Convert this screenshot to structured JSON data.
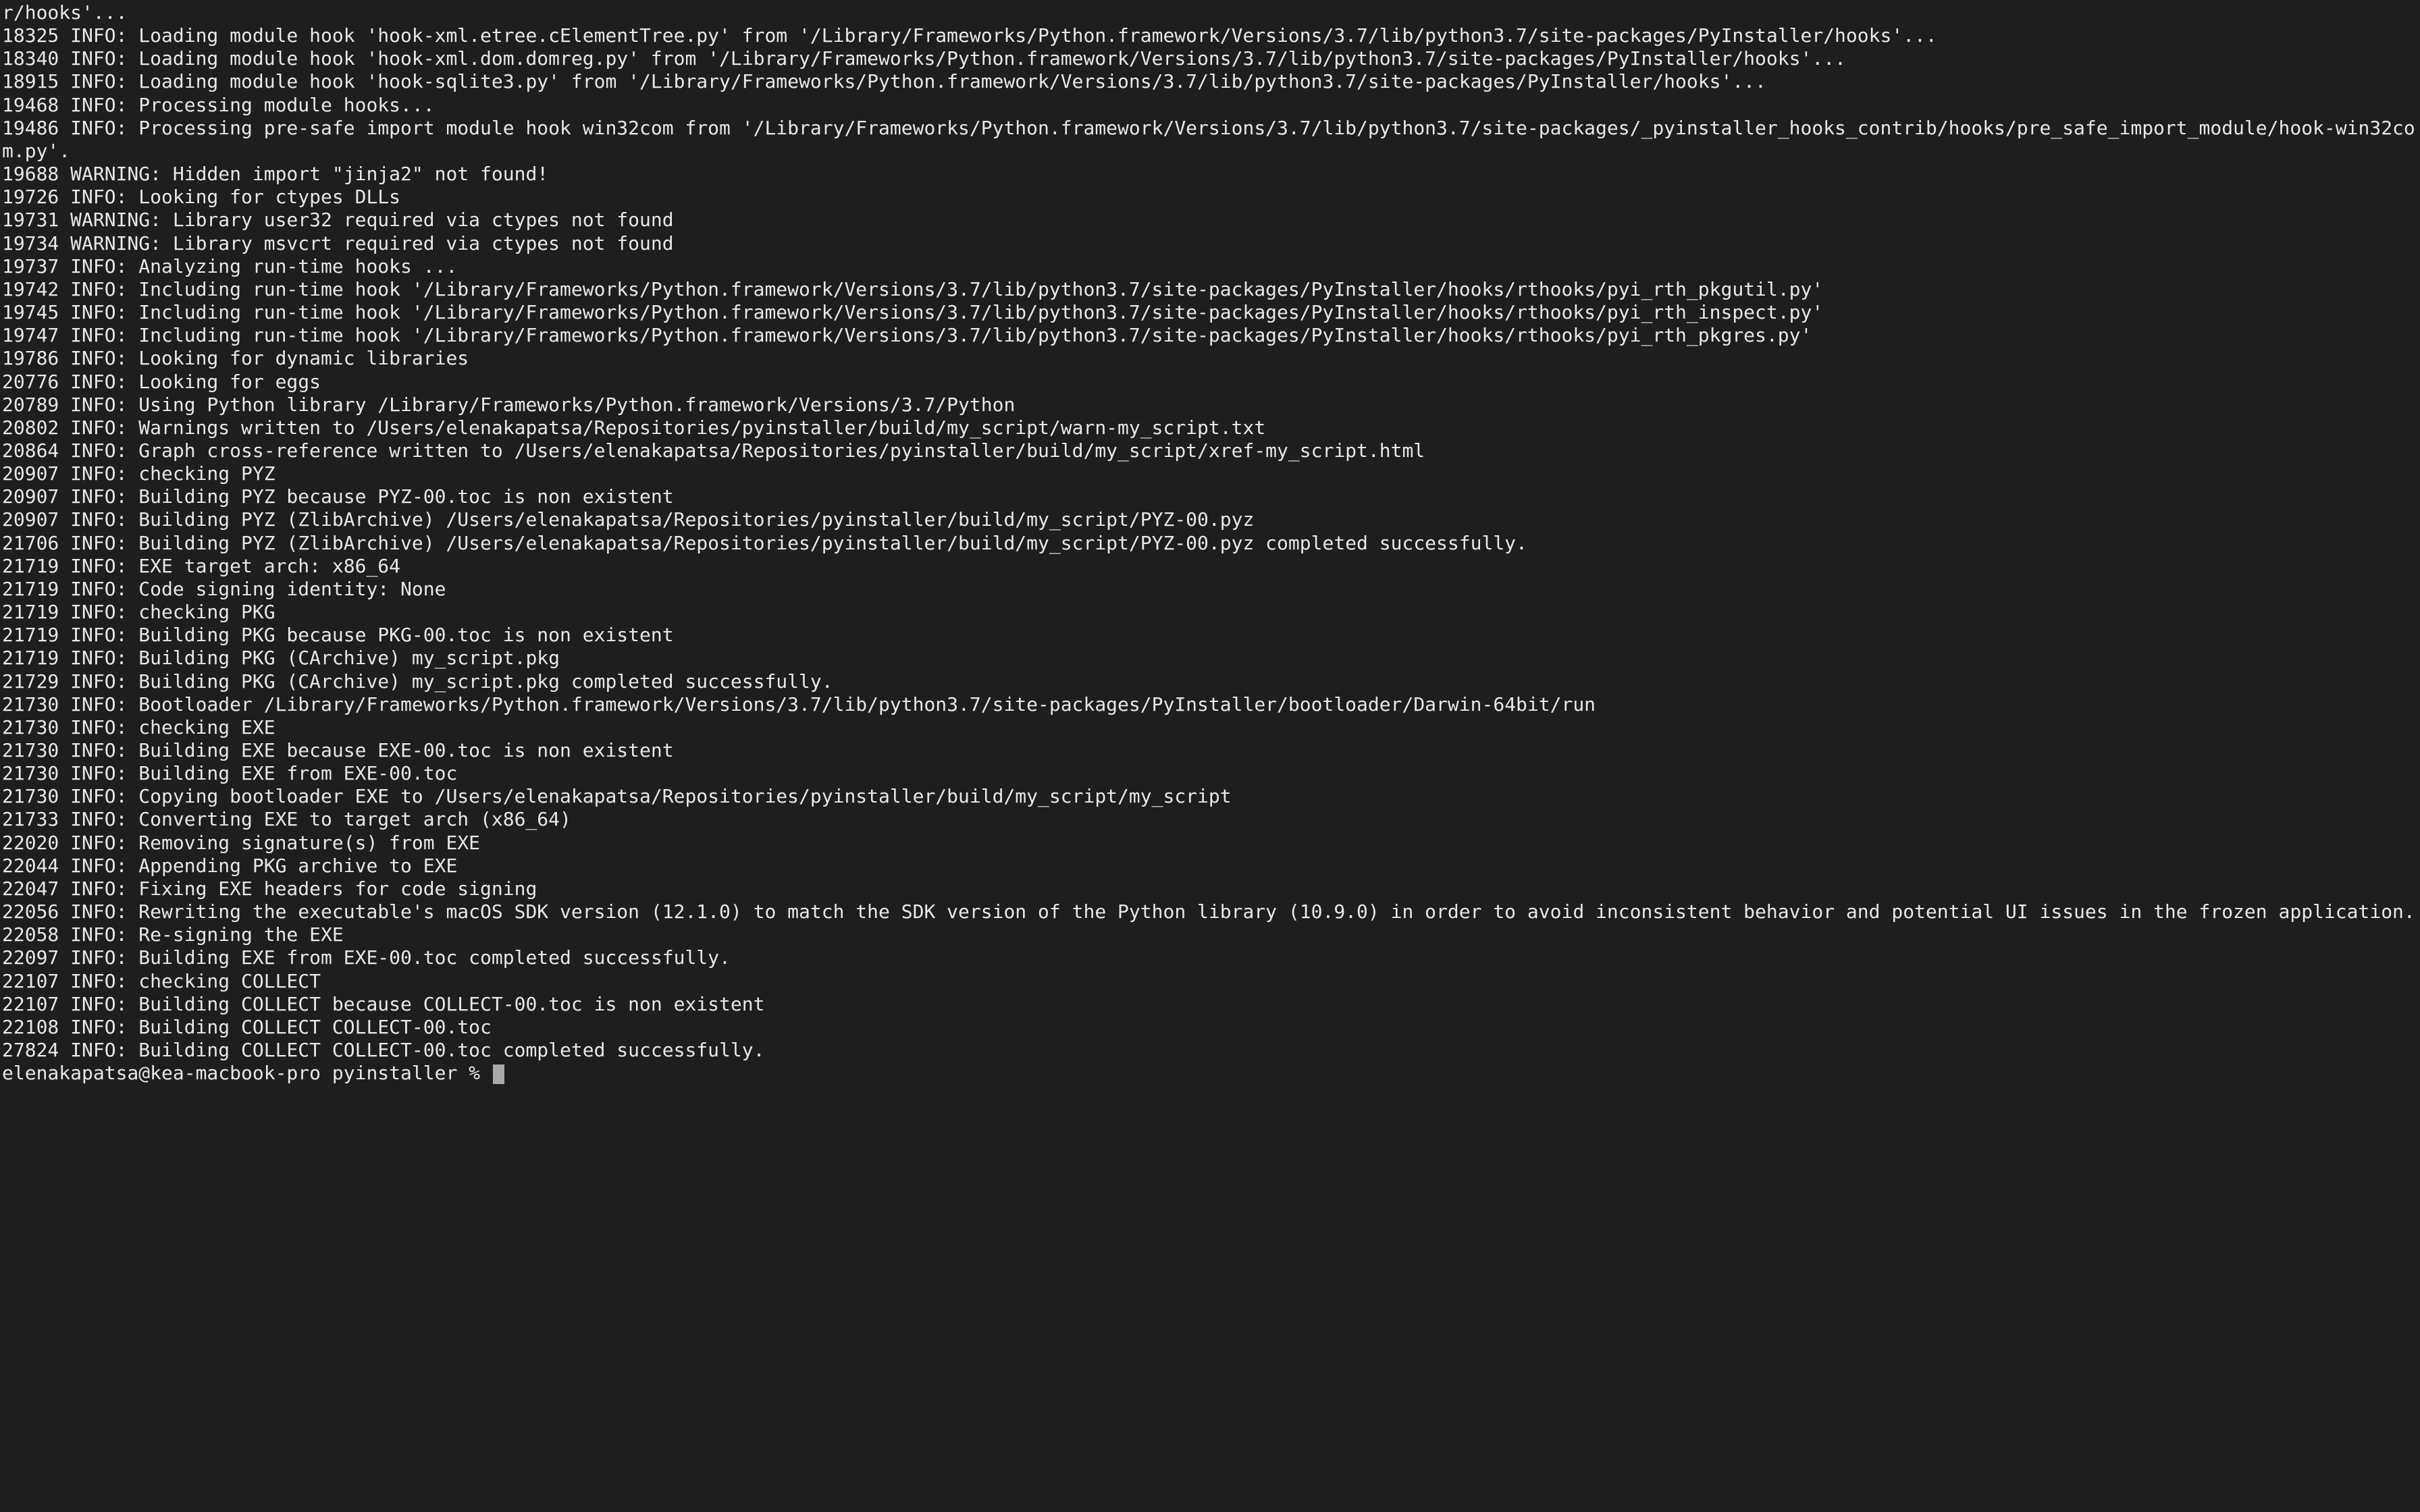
{
  "terminal": {
    "lines": [
      "r/hooks'...",
      "18325 INFO: Loading module hook 'hook-xml.etree.cElementTree.py' from '/Library/Frameworks/Python.framework/Versions/3.7/lib/python3.7/site-packages/PyInstaller/hooks'...",
      "18340 INFO: Loading module hook 'hook-xml.dom.domreg.py' from '/Library/Frameworks/Python.framework/Versions/3.7/lib/python3.7/site-packages/PyInstaller/hooks'...",
      "18915 INFO: Loading module hook 'hook-sqlite3.py' from '/Library/Frameworks/Python.framework/Versions/3.7/lib/python3.7/site-packages/PyInstaller/hooks'...",
      "19468 INFO: Processing module hooks...",
      "19486 INFO: Processing pre-safe import module hook win32com from '/Library/Frameworks/Python.framework/Versions/3.7/lib/python3.7/site-packages/_pyinstaller_hooks_contrib/hooks/pre_safe_import_module/hook-win32com.py'.",
      "19688 WARNING: Hidden import \"jinja2\" not found!",
      "19726 INFO: Looking for ctypes DLLs",
      "19731 WARNING: Library user32 required via ctypes not found",
      "19734 WARNING: Library msvcrt required via ctypes not found",
      "19737 INFO: Analyzing run-time hooks ...",
      "19742 INFO: Including run-time hook '/Library/Frameworks/Python.framework/Versions/3.7/lib/python3.7/site-packages/PyInstaller/hooks/rthooks/pyi_rth_pkgutil.py'",
      "19745 INFO: Including run-time hook '/Library/Frameworks/Python.framework/Versions/3.7/lib/python3.7/site-packages/PyInstaller/hooks/rthooks/pyi_rth_inspect.py'",
      "19747 INFO: Including run-time hook '/Library/Frameworks/Python.framework/Versions/3.7/lib/python3.7/site-packages/PyInstaller/hooks/rthooks/pyi_rth_pkgres.py'",
      "19786 INFO: Looking for dynamic libraries",
      "20776 INFO: Looking for eggs",
      "20789 INFO: Using Python library /Library/Frameworks/Python.framework/Versions/3.7/Python",
      "20802 INFO: Warnings written to /Users/elenakapatsa/Repositories/pyinstaller/build/my_script/warn-my_script.txt",
      "20864 INFO: Graph cross-reference written to /Users/elenakapatsa/Repositories/pyinstaller/build/my_script/xref-my_script.html",
      "20907 INFO: checking PYZ",
      "20907 INFO: Building PYZ because PYZ-00.toc is non existent",
      "20907 INFO: Building PYZ (ZlibArchive) /Users/elenakapatsa/Repositories/pyinstaller/build/my_script/PYZ-00.pyz",
      "21706 INFO: Building PYZ (ZlibArchive) /Users/elenakapatsa/Repositories/pyinstaller/build/my_script/PYZ-00.pyz completed successfully.",
      "21719 INFO: EXE target arch: x86_64",
      "21719 INFO: Code signing identity: None",
      "21719 INFO: checking PKG",
      "21719 INFO: Building PKG because PKG-00.toc is non existent",
      "21719 INFO: Building PKG (CArchive) my_script.pkg",
      "21729 INFO: Building PKG (CArchive) my_script.pkg completed successfully.",
      "21730 INFO: Bootloader /Library/Frameworks/Python.framework/Versions/3.7/lib/python3.7/site-packages/PyInstaller/bootloader/Darwin-64bit/run",
      "21730 INFO: checking EXE",
      "21730 INFO: Building EXE because EXE-00.toc is non existent",
      "21730 INFO: Building EXE from EXE-00.toc",
      "21730 INFO: Copying bootloader EXE to /Users/elenakapatsa/Repositories/pyinstaller/build/my_script/my_script",
      "21733 INFO: Converting EXE to target arch (x86_64)",
      "22020 INFO: Removing signature(s) from EXE",
      "22044 INFO: Appending PKG archive to EXE",
      "22047 INFO: Fixing EXE headers for code signing",
      "22056 INFO: Rewriting the executable's macOS SDK version (12.1.0) to match the SDK version of the Python library (10.9.0) in order to avoid inconsistent behavior and potential UI issues in the frozen application.",
      "22058 INFO: Re-signing the EXE",
      "22097 INFO: Building EXE from EXE-00.toc completed successfully.",
      "22107 INFO: checking COLLECT",
      "22107 INFO: Building COLLECT because COLLECT-00.toc is non existent",
      "22108 INFO: Building COLLECT COLLECT-00.toc",
      "27824 INFO: Building COLLECT COLLECT-00.toc completed successfully."
    ],
    "prompt": "elenakapatsa@kea-macbook-pro pyinstaller % "
  }
}
